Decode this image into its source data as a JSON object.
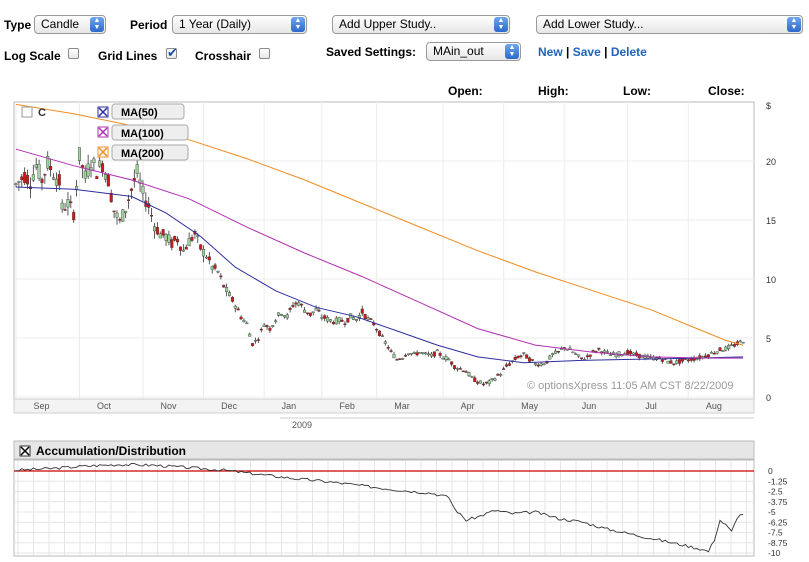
{
  "toolbar": {
    "type_label": "Type",
    "type_value": "Candle",
    "period_label": "Period",
    "period_value": "1 Year (Daily)",
    "upper_study": "Add Upper Study..",
    "lower_study": "Add Lower Study...",
    "log_scale": "Log Scale",
    "grid_lines": "Grid Lines",
    "crosshair": "Crosshair",
    "log_checked": false,
    "grid_checked": true,
    "crosshair_checked": false,
    "saved_label": "Saved Settings:",
    "saved_value": "MAin_out",
    "new": "New",
    "sep1": "|",
    "save": "Save",
    "sep2": "|",
    "delete": "Delete"
  },
  "ohlc": {
    "open": "Open:",
    "high": "High:",
    "low": "Low:",
    "close": "Close:"
  },
  "legend": {
    "symbol": "C",
    "ma50": "MA(50)",
    "ma100": "MA(100)",
    "ma200": "MA(200)"
  },
  "colors": {
    "candle_up": "#9fd59a",
    "candle_down": "#d01818",
    "ma50": "#2e2ea0",
    "ma100": "#b030b0",
    "ma200": "#f08c20",
    "accent": "#1d64b8"
  },
  "watermark": "© optionsXpress 11:05 AM CST 8/22/2009",
  "year_label": "2009",
  "lower_panel_title": "Accumulation/Distribution",
  "chart_data": [
    {
      "type": "candlestick",
      "ylabel": "$",
      "ylim": [
        0,
        25
      ],
      "yticks": [
        0,
        5,
        10,
        15,
        20
      ],
      "months": [
        "Sep",
        "Oct",
        "Nov",
        "Dec",
        "Jan",
        "Feb",
        "Mar",
        "Apr",
        "May",
        "Jun",
        "Jul",
        "Aug"
      ],
      "grid": true,
      "legend_position": "top-left",
      "price_path": [
        [
          0,
          18.0
        ],
        [
          3,
          18.8
        ],
        [
          5,
          18.3
        ],
        [
          7,
          19.6
        ],
        [
          9,
          18.4
        ],
        [
          11,
          19.8
        ],
        [
          13,
          19.0
        ],
        [
          15,
          18.2
        ],
        [
          16,
          16.0
        ],
        [
          18,
          16.4
        ],
        [
          20,
          15.6
        ],
        [
          22,
          20.4
        ],
        [
          24,
          18.6
        ],
        [
          26,
          20.0
        ],
        [
          28,
          19.2
        ],
        [
          30,
          19.8
        ],
        [
          32,
          18.4
        ],
        [
          34,
          15.8
        ],
        [
          36,
          14.8
        ],
        [
          38,
          16.0
        ],
        [
          40,
          17.6
        ],
        [
          42,
          19.0
        ],
        [
          44,
          17.2
        ],
        [
          46,
          16.2
        ],
        [
          48,
          14.6
        ],
        [
          50,
          13.8
        ],
        [
          52,
          13.6
        ],
        [
          54,
          13.0
        ],
        [
          56,
          13.4
        ],
        [
          58,
          12.4
        ],
        [
          60,
          13.2
        ],
        [
          62,
          13.8
        ],
        [
          64,
          12.6
        ],
        [
          66,
          12.0
        ],
        [
          68,
          11.0
        ],
        [
          70,
          10.6
        ],
        [
          72,
          9.4
        ],
        [
          74,
          8.6
        ],
        [
          76,
          7.8
        ],
        [
          78,
          6.8
        ],
        [
          80,
          6.2
        ],
        [
          82,
          4.5
        ],
        [
          84,
          5.0
        ],
        [
          86,
          6.2
        ],
        [
          88,
          5.8
        ],
        [
          90,
          6.6
        ],
        [
          92,
          7.2
        ],
        [
          94,
          6.8
        ],
        [
          96,
          7.8
        ],
        [
          98,
          8.0
        ],
        [
          100,
          7.4
        ],
        [
          102,
          7.0
        ],
        [
          104,
          7.4
        ],
        [
          106,
          6.8
        ],
        [
          108,
          6.6
        ],
        [
          110,
          6.4
        ],
        [
          112,
          6.5
        ],
        [
          114,
          6.4
        ],
        [
          116,
          6.8
        ],
        [
          118,
          6.6
        ],
        [
          120,
          7.2
        ],
        [
          122,
          6.6
        ],
        [
          124,
          6.2
        ],
        [
          126,
          5.4
        ],
        [
          128,
          4.6
        ],
        [
          130,
          3.8
        ],
        [
          132,
          3.2
        ],
        [
          134,
          3.4
        ],
        [
          136,
          3.8
        ],
        [
          138,
          3.6
        ],
        [
          140,
          3.8
        ],
        [
          142,
          3.6
        ],
        [
          144,
          3.5
        ],
        [
          146,
          3.8
        ],
        [
          148,
          3.4
        ],
        [
          150,
          3.2
        ],
        [
          152,
          2.6
        ],
        [
          154,
          2.4
        ],
        [
          156,
          2.2
        ],
        [
          158,
          1.6
        ],
        [
          160,
          1.3
        ],
        [
          162,
          1.1
        ],
        [
          164,
          1.2
        ],
        [
          166,
          1.6
        ],
        [
          168,
          2.0
        ],
        [
          170,
          2.6
        ],
        [
          172,
          3.0
        ],
        [
          174,
          3.4
        ],
        [
          176,
          3.6
        ],
        [
          178,
          3.2
        ],
        [
          180,
          2.8
        ],
        [
          182,
          2.8
        ],
        [
          184,
          3.0
        ],
        [
          186,
          3.6
        ],
        [
          188,
          3.8
        ],
        [
          190,
          4.2
        ],
        [
          192,
          4.0
        ],
        [
          194,
          3.6
        ],
        [
          196,
          3.2
        ],
        [
          198,
          3.4
        ],
        [
          200,
          3.8
        ],
        [
          202,
          4.0
        ],
        [
          204,
          3.8
        ],
        [
          206,
          3.6
        ],
        [
          208,
          3.6
        ],
        [
          210,
          3.7
        ],
        [
          212,
          3.8
        ],
        [
          214,
          3.6
        ],
        [
          216,
          3.5
        ],
        [
          218,
          3.4
        ],
        [
          220,
          3.3
        ],
        [
          222,
          3.3
        ],
        [
          224,
          3.2
        ],
        [
          226,
          3.0
        ],
        [
          228,
          2.9
        ],
        [
          230,
          3.0
        ],
        [
          232,
          3.1
        ],
        [
          234,
          3.2
        ],
        [
          236,
          3.3
        ],
        [
          238,
          3.4
        ],
        [
          240,
          3.6
        ],
        [
          242,
          3.8
        ],
        [
          244,
          4.0
        ],
        [
          246,
          4.1
        ],
        [
          248,
          4.3
        ],
        [
          250,
          4.5
        ],
        [
          252,
          4.8
        ]
      ],
      "series": [
        {
          "name": "C",
          "style": "candle"
        },
        {
          "name": "MA(50)",
          "color": "#2e2ea0",
          "points": [
            [
              0,
              17.8
            ],
            [
              20,
              17.6
            ],
            [
              40,
              17.0
            ],
            [
              52,
              15.6
            ],
            [
              64,
              13.6
            ],
            [
              76,
              11.0
            ],
            [
              90,
              9.0
            ],
            [
              104,
              7.6
            ],
            [
              118,
              6.8
            ],
            [
              132,
              5.6
            ],
            [
              146,
              4.4
            ],
            [
              160,
              3.4
            ],
            [
              176,
              2.9
            ],
            [
              196,
              3.1
            ],
            [
              216,
              3.2
            ],
            [
              236,
              3.3
            ],
            [
              252,
              3.4
            ]
          ]
        },
        {
          "name": "MA(100)",
          "color": "#b030b0",
          "points": [
            [
              0,
              21.0
            ],
            [
              20,
              19.6
            ],
            [
              40,
              18.4
            ],
            [
              60,
              16.8
            ],
            [
              80,
              14.4
            ],
            [
              100,
              12.2
            ],
            [
              120,
              10.2
            ],
            [
              140,
              8.0
            ],
            [
              160,
              5.8
            ],
            [
              180,
              4.4
            ],
            [
              200,
              3.8
            ],
            [
              220,
              3.4
            ],
            [
              240,
              3.3
            ],
            [
              252,
              3.3
            ]
          ]
        },
        {
          "name": "MA(200)",
          "color": "#f08c20",
          "points": [
            [
              0,
              24.8
            ],
            [
              20,
              24.0
            ],
            [
              40,
              23.0
            ],
            [
              60,
              21.8
            ],
            [
              80,
              20.2
            ],
            [
              100,
              18.4
            ],
            [
              120,
              16.4
            ],
            [
              140,
              14.4
            ],
            [
              160,
              12.4
            ],
            [
              180,
              10.6
            ],
            [
              200,
              9.0
            ],
            [
              220,
              7.4
            ],
            [
              236,
              5.8
            ],
            [
              246,
              4.8
            ],
            [
              252,
              4.4
            ]
          ]
        }
      ]
    },
    {
      "type": "line",
      "title": "Accumulation/Distribution",
      "ylim": [
        -10,
        0
      ],
      "yticks": [
        0,
        -1.25,
        -2.5,
        -3.75,
        -5,
        -6.25,
        -7.5,
        -8.75,
        -10
      ],
      "ytick_labels": [
        "0",
        "-1.25",
        "-2.5",
        "-3.75",
        "-5",
        "-6.25",
        "-7.5",
        "-8.75",
        "-10"
      ],
      "reference_line": 0,
      "series": [
        {
          "name": "Accumulation/Distribution",
          "color": "#333333",
          "points": [
            [
              0,
              0.1
            ],
            [
              12,
              0.3
            ],
            [
              24,
              0.6
            ],
            [
              36,
              0.8
            ],
            [
              48,
              0.7
            ],
            [
              60,
              0.4
            ],
            [
              72,
              0.1
            ],
            [
              84,
              -0.4
            ],
            [
              96,
              -0.9
            ],
            [
              108,
              -1.3
            ],
            [
              120,
              -1.8
            ],
            [
              132,
              -2.3
            ],
            [
              144,
              -2.7
            ],
            [
              150,
              -3.2
            ],
            [
              152,
              -4.6
            ],
            [
              156,
              -6.0
            ],
            [
              160,
              -5.6
            ],
            [
              166,
              -4.8
            ],
            [
              172,
              -5.2
            ],
            [
              180,
              -5.0
            ],
            [
              188,
              -5.8
            ],
            [
              196,
              -6.2
            ],
            [
              204,
              -7.0
            ],
            [
              212,
              -7.6
            ],
            [
              220,
              -8.2
            ],
            [
              228,
              -8.8
            ],
            [
              236,
              -9.4
            ],
            [
              240,
              -9.8
            ],
            [
              242,
              -8.4
            ],
            [
              244,
              -6.0
            ],
            [
              246,
              -6.6
            ],
            [
              248,
              -7.4
            ],
            [
              250,
              -5.6
            ],
            [
              252,
              -5.2
            ]
          ]
        }
      ]
    }
  ]
}
